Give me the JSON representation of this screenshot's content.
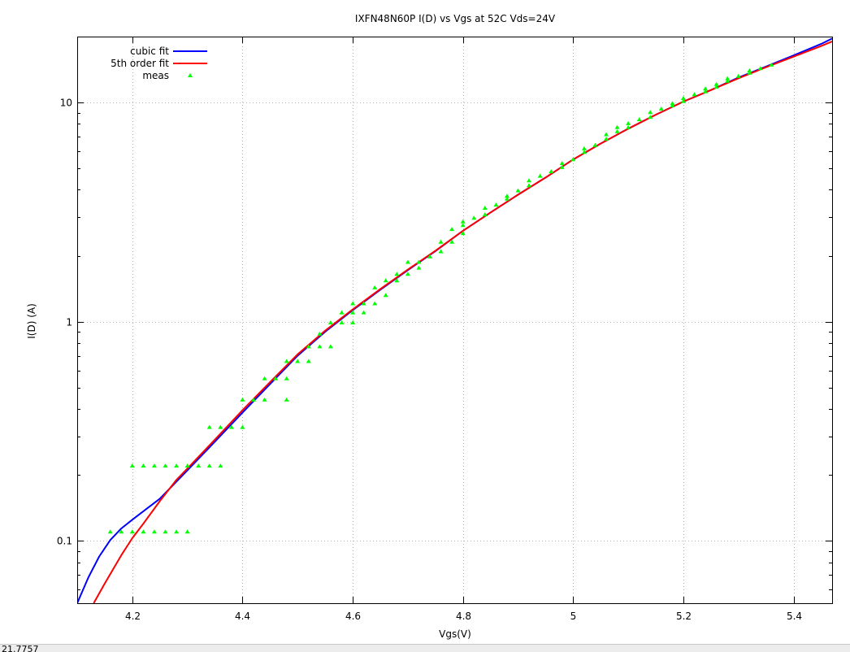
{
  "status_bar": {
    "text": "21.7757"
  },
  "chart_data": {
    "type": "scatter",
    "title": "IXFN48N60P I(D) vs Vgs at 52C Vds=24V",
    "xlabel": "Vgs(V)",
    "ylabel": "I(D) (A)",
    "xlim": [
      4.1,
      5.47
    ],
    "ylim": [
      0.052,
      20
    ],
    "yscale": "log",
    "grid": true,
    "legend_position": "top-left",
    "x_ticks": [
      4.2,
      4.4,
      4.6,
      4.8,
      5,
      5.2,
      5.4
    ],
    "x_tick_labels": [
      "4.2",
      "4.4",
      "4.6",
      "4.8",
      "5",
      "5.2",
      "5.4"
    ],
    "y_ticks": [
      0.1,
      1,
      10
    ],
    "y_tick_labels": [
      "0.1",
      "1",
      "10"
    ],
    "series": [
      {
        "name": "cubic fit",
        "kind": "line",
        "color": "#0000ff",
        "x": [
          4.1,
          4.12,
          4.14,
          4.16,
          4.18,
          4.2,
          4.25,
          4.3,
          4.35,
          4.4,
          4.45,
          4.5,
          4.55,
          4.6,
          4.65,
          4.7,
          4.75,
          4.8,
          4.85,
          4.9,
          4.95,
          5.0,
          5.05,
          5.1,
          5.15,
          5.2,
          5.25,
          5.3,
          5.35,
          5.4,
          5.45,
          5.47
        ],
        "y": [
          0.052,
          0.068,
          0.085,
          0.101,
          0.114,
          0.125,
          0.156,
          0.21,
          0.284,
          0.385,
          0.52,
          0.7,
          0.9,
          1.13,
          1.4,
          1.72,
          2.1,
          2.6,
          3.15,
          3.8,
          4.55,
          5.5,
          6.5,
          7.6,
          8.8,
          10.1,
          11.4,
          13,
          14.6,
          16.4,
          18.5,
          19.6
        ]
      },
      {
        "name": "5th order fit",
        "kind": "line",
        "color": "#ff0000",
        "x": [
          4.13,
          4.15,
          4.18,
          4.2,
          4.22,
          4.25,
          4.28,
          4.3,
          4.35,
          4.4,
          4.45,
          4.5,
          4.55,
          4.6,
          4.65,
          4.7,
          4.75,
          4.8,
          4.85,
          4.9,
          4.95,
          5.0,
          5.05,
          5.1,
          5.15,
          5.2,
          5.25,
          5.3,
          5.35,
          5.4,
          5.45,
          5.47
        ],
        "y": [
          0.052,
          0.064,
          0.086,
          0.103,
          0.12,
          0.152,
          0.19,
          0.214,
          0.29,
          0.395,
          0.53,
          0.71,
          0.91,
          1.14,
          1.41,
          1.73,
          2.11,
          2.6,
          3.15,
          3.8,
          4.55,
          5.5,
          6.5,
          7.6,
          8.8,
          10.1,
          11.4,
          12.9,
          14.5,
          16.2,
          18.1,
          19.0
        ]
      },
      {
        "name": "meas",
        "kind": "points",
        "color": "#00ff00",
        "x": [
          4.16,
          4.18,
          4.2,
          4.22,
          4.24,
          4.26,
          4.28,
          4.3,
          4.2,
          4.22,
          4.24,
          4.26,
          4.28,
          4.3,
          4.32,
          4.34,
          4.36,
          4.34,
          4.36,
          4.38,
          4.4,
          4.4,
          4.42,
          4.44,
          4.44,
          4.46,
          4.48,
          4.48,
          4.48,
          4.5,
          4.52,
          4.52,
          4.54,
          4.54,
          4.56,
          4.56,
          4.58,
          4.58,
          4.6,
          4.6,
          4.6,
          4.62,
          4.62,
          4.64,
          4.64,
          4.66,
          4.66,
          4.68,
          4.68,
          4.7,
          4.7,
          4.72,
          4.72,
          4.74,
          4.76,
          4.76,
          4.78,
          4.78,
          4.8,
          4.8,
          4.8,
          4.82,
          4.84,
          4.84,
          4.86,
          4.88,
          4.88,
          4.9,
          4.92,
          4.92,
          4.94,
          4.96,
          4.98,
          4.98,
          5.0,
          5.02,
          5.02,
          5.04,
          5.06,
          5.06,
          5.08,
          5.08,
          5.1,
          5.1,
          5.12,
          5.14,
          5.14,
          5.16,
          5.18,
          5.18,
          5.2,
          5.2,
          5.22,
          5.24,
          5.24,
          5.26,
          5.26,
          5.28,
          5.28,
          5.3,
          5.32,
          5.32,
          5.34,
          5.36
        ],
        "y": [
          0.11,
          0.11,
          0.11,
          0.11,
          0.11,
          0.11,
          0.11,
          0.11,
          0.22,
          0.22,
          0.22,
          0.22,
          0.22,
          0.22,
          0.22,
          0.22,
          0.22,
          0.33,
          0.33,
          0.33,
          0.33,
          0.44,
          0.44,
          0.44,
          0.55,
          0.55,
          0.44,
          0.55,
          0.66,
          0.66,
          0.66,
          0.77,
          0.77,
          0.88,
          0.77,
          0.99,
          0.99,
          1.1,
          0.99,
          1.1,
          1.21,
          1.1,
          1.21,
          1.21,
          1.43,
          1.32,
          1.54,
          1.54,
          1.65,
          1.65,
          1.87,
          1.76,
          1.87,
          1.98,
          2.09,
          2.31,
          2.31,
          2.64,
          2.53,
          2.75,
          2.86,
          2.97,
          3.08,
          3.3,
          3.41,
          3.63,
          3.74,
          3.96,
          4.18,
          4.4,
          4.62,
          4.84,
          5.06,
          5.28,
          5.5,
          5.94,
          6.16,
          6.38,
          6.82,
          7.15,
          7.37,
          7.7,
          7.7,
          8.03,
          8.36,
          8.58,
          9.02,
          9.35,
          9.68,
          9.9,
          10.12,
          10.45,
          10.89,
          11.22,
          11.55,
          11.77,
          12.1,
          12.54,
          12.87,
          13.2,
          13.64,
          13.97,
          14.3,
          14.85
        ]
      }
    ]
  }
}
